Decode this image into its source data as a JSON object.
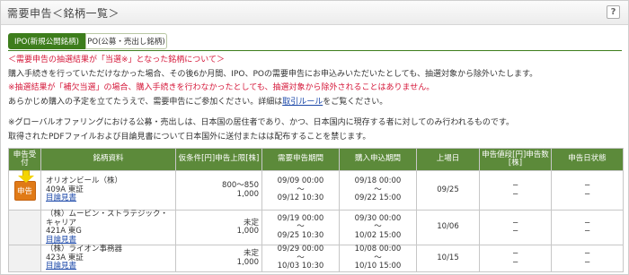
{
  "header": {
    "title": "需要申告＜銘柄一覧＞",
    "help_label": "?"
  },
  "tabs": [
    {
      "label": "IPO(新規公開銘柄)",
      "active": true
    },
    {
      "label": "PO(公募・売出し銘柄)",
      "active": false
    }
  ],
  "notes": {
    "line1": "＜需要申告の抽選結果が「当選※」となった銘柄について＞",
    "line2": "購入手続きを行っていただけなかった場合、その後6か月間、IPO、POの需要申告にお申込みいただいたとしても、抽選対象から除外いたします。",
    "line3": "※抽選結果が「補欠当選」の場合、購入手続きを行わなかったとしても、抽選対象から除外されることはありません。",
    "line4_pre": "あらかじめ購入の予定を立てたうえで、需要申告にご参加ください。詳細は",
    "line4_link": "取引ルール",
    "line4_post": "をご覧ください。",
    "line5": "※グローバルオファリングにおける公募・売出しは、日本国の居住者であり、かつ、日本国内に現存する者に対してのみ行われるものです。",
    "line6": "取得されたPDFファイルおよび目論見書について日本国外に送付またはは配布することを禁じます。"
  },
  "table": {
    "headers": {
      "apply": "申告受付",
      "issue": "銘柄資料",
      "price": "仮条件[円]申告上限[株]",
      "period": "需要申告期間",
      "purchase": "購入申込期間",
      "listing": "上場日",
      "bid": "申告値段[円]申告数[株]",
      "status": "申告日状態"
    },
    "rows": [
      {
        "apply_label": "申告",
        "name": "オリオンビール（株）",
        "code": "409A 東証",
        "doc": "目論見書",
        "price": "800〜850",
        "limit": "1,000",
        "period_start": "09/09 00:00",
        "period_end": "09/12 10:30",
        "purchase_start": "09/18 00:00",
        "purchase_end": "09/22 15:00",
        "listing": "09/25",
        "bid1": "−",
        "bid2": "−",
        "status1": "−",
        "status2": "−"
      },
      {
        "apply_label": "",
        "name": "（株）ムービン・ストラテジック・キャリア",
        "code": "421A 東G",
        "doc": "目論見書",
        "price": "未定",
        "limit": "1,000",
        "period_start": "09/19 00:00",
        "period_end": "09/25 10:30",
        "purchase_start": "09/30 00:00",
        "purchase_end": "10/02 15:00",
        "listing": "10/06",
        "bid1": "−",
        "bid2": "−",
        "status1": "−",
        "status2": "−"
      },
      {
        "apply_label": "",
        "name": "（株）ライオン事務器",
        "code": "423A 東証",
        "doc": "目論見書",
        "price": "未定",
        "limit": "1,000",
        "period_start": "09/29 00:00",
        "period_end": "10/03 10:30",
        "purchase_start": "10/08 00:00",
        "purchase_end": "10/10 15:00",
        "listing": "10/15",
        "bid1": "−",
        "bid2": "−",
        "status1": "−",
        "status2": "−"
      }
    ]
  },
  "colors": {
    "accent_green": "#3d7d1c",
    "header_green": "#5c8a3a",
    "note_red": "#d5183a",
    "apply_orange": "#e07a16",
    "arrow_yellow": "#f4d400"
  },
  "icons": {
    "apply_pointer": "arrow-down-icon",
    "help": "question-icon"
  }
}
